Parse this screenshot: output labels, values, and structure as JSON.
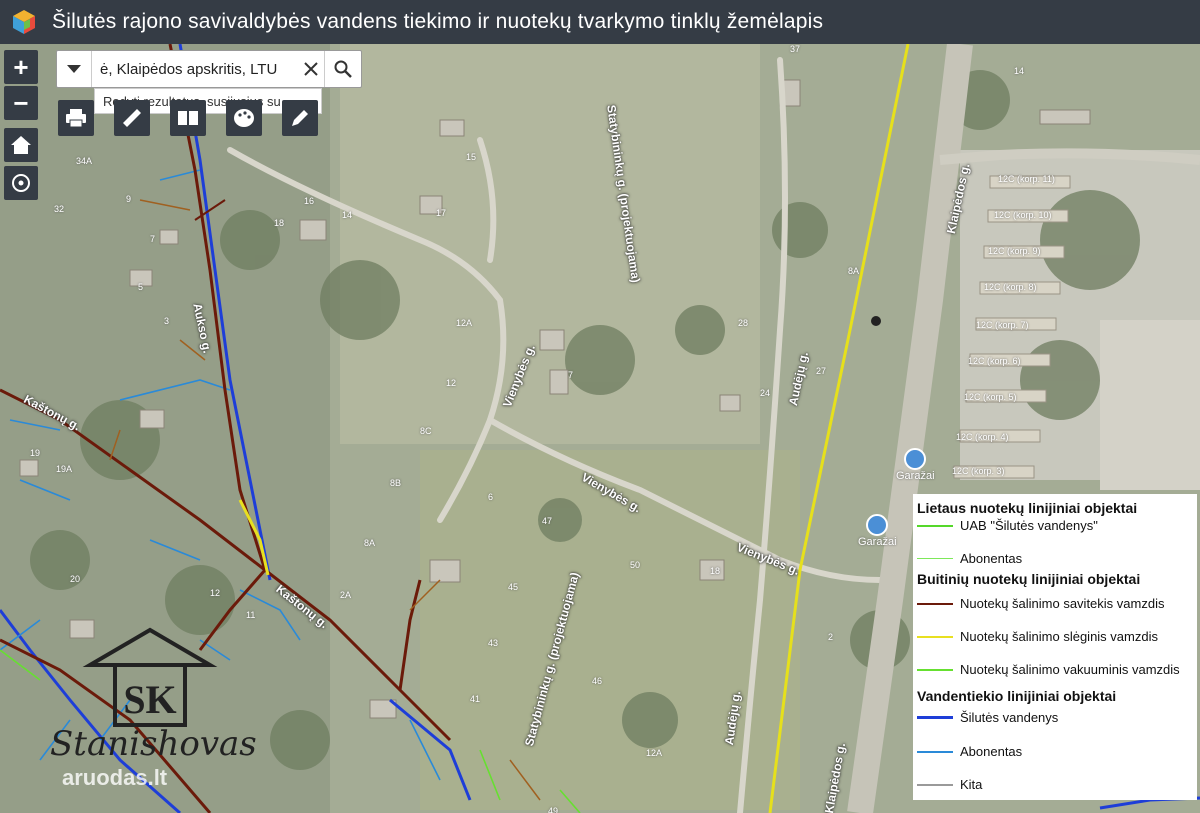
{
  "header": {
    "title": "Šilutės rajono savivaldybės vandens tiekimo ir nuotekų tvarkymo tinklų žemėlapis"
  },
  "controls": {
    "zoom_in": "+",
    "zoom_out": "−"
  },
  "search": {
    "value": "ė, Klaipėdos apskritis, LTU",
    "suggestion": "Rodyti rezultatus, susijusius su ..."
  },
  "streets": {
    "vienybes_1": "Vienybės g.",
    "vienybes_2": "Vienybės g.",
    "vienybes_3": "Vienybės g.",
    "statybininku_1": "Statybininkų g. (projektuojama)",
    "statybininku_2": "Statybininkų g. (projektuojama)",
    "audeju_1": "Audėjų g.",
    "audeju_2": "Audėjų g.",
    "klaipedos_1": "Klaipėdos g.",
    "klaipedos_2": "Klaipėdos g.",
    "kastoniu_1": "Kaštonų g.",
    "kastoniu_2": "Kaštonų g.",
    "aukso": "Aukso g."
  },
  "poi": {
    "garazai_1": "Garažai",
    "garazai_2": "Garažai"
  },
  "house_numbers": {
    "n37": "37",
    "n14": "14",
    "n34a": "34A",
    "n32": "32",
    "n15": "15",
    "n17": "17",
    "n16": "16",
    "n14b": "14",
    "n18": "18",
    "n9": "9",
    "n7": "7",
    "n3": "3",
    "n5": "5",
    "n12a": "12A",
    "n12": "12",
    "n8c": "8C",
    "n8b": "8B",
    "n6": "6",
    "n47": "47",
    "n50": "50",
    "n45": "45",
    "n43": "43",
    "n46": "46",
    "n41": "41",
    "n12a2": "12A",
    "n49": "49",
    "n28": "28",
    "n27": "27",
    "n24": "24",
    "n8a": "8A",
    "n18b": "18",
    "n2": "2",
    "n19": "19",
    "n19a": "19A",
    "n20": "20",
    "n12b": "12",
    "n11": "11",
    "n2a": "2A",
    "n8a2": "8A",
    "c10": "12C (korp. 10)",
    "c11": "12C (korp. 11)",
    "c9": "12C (korp. 9)",
    "c8": "12C (korp. 8)",
    "c7": "12C (korp. 7)",
    "c5": "12C (korp. 5)",
    "c6": "12C (korp. 6)",
    "c4": "12C (korp. 4)",
    "c3": "12C (korp. 3)"
  },
  "legend": {
    "group1": "Lietaus nuotekų linijiniai objektai",
    "item_uab": "UAB \"Šilutės vandenys\"",
    "item_abon1": "Abonentas",
    "group2": "Buitinių nuotekų linijiniai objektai",
    "item_savitek": "Nuotekų šalinimo savitekis vamzdis",
    "item_sleg": "Nuotekų šalinimo slėginis vamzdis",
    "item_vak": "Nuotekų šalinimo vakuuminis vamzdis",
    "group3": "Vandentiekio linijiniai objektai",
    "item_silutes": "Šilutės vandenys",
    "item_abon2": "Abonentas",
    "item_kita": "Kita"
  },
  "colors": {
    "rain_uab": "#55d82a",
    "rain_abon": "#7ee85a",
    "sewer_gravity": "#6b1a0a",
    "sewer_pressure": "#e8e020",
    "sewer_vacuum": "#66e030",
    "water_main": "#1e3ed8",
    "water_abon": "#2a8ad8",
    "other": "#9a9a9a"
  },
  "watermark": {
    "brand": "Stanishovas",
    "site": "aruodas.lt",
    "logo_letters": "SK"
  }
}
